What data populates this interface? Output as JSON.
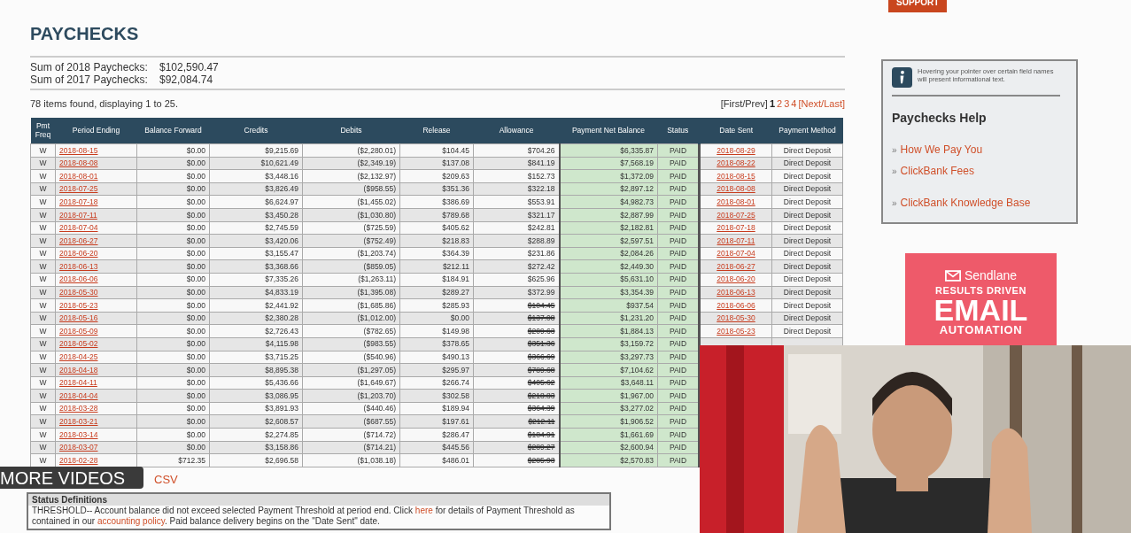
{
  "support_button": {
    "label": "SUPPORT"
  },
  "title": "PAYCHECKS",
  "sums": [
    {
      "label": "Sum of 2018 Paychecks:",
      "value": "$102,590.47"
    },
    {
      "label": "Sum of 2017 Paychecks:",
      "value": "$92,084.74"
    }
  ],
  "items_found": "78 items found, displaying 1 to 25.",
  "pager": {
    "first_prev": "[First/Prev]",
    "pages": [
      {
        "label": "1",
        "selected": true
      },
      {
        "label": "2",
        "selected": false
      },
      {
        "label": "3",
        "selected": false
      },
      {
        "label": "4",
        "selected": false
      }
    ],
    "next_last": "[Next/Last]"
  },
  "table": {
    "columns": [
      "Pmt Freq",
      "Period Ending",
      "Balance Forward",
      "Credits",
      "Debits",
      "Release",
      "Allowance",
      "Payment Net Balance",
      "Status",
      "Date Sent",
      "Payment Method"
    ],
    "rows": [
      {
        "freq": "W",
        "period_ending": "2018-08-15",
        "balance_forward": "$0.00",
        "credits": "$9,215.69",
        "debits": "($2,280.01)",
        "release": "$104.45",
        "allowance": "$704.26",
        "allowance_voided": false,
        "net_balance": "$6,335.87",
        "status": "PAID",
        "date_sent": "2018-08-29",
        "payment_method": "Direct Deposit"
      },
      {
        "freq": "W",
        "period_ending": "2018-08-08",
        "balance_forward": "$0.00",
        "credits": "$10,621.49",
        "debits": "($2,349.19)",
        "release": "$137.08",
        "allowance": "$841.19",
        "allowance_voided": false,
        "net_balance": "$7,568.19",
        "status": "PAID",
        "date_sent": "2018-08-22",
        "payment_method": "Direct Deposit"
      },
      {
        "freq": "W",
        "period_ending": "2018-08-01",
        "balance_forward": "$0.00",
        "credits": "$3,448.16",
        "debits": "($2,132.97)",
        "release": "$209.63",
        "allowance": "$152.73",
        "allowance_voided": false,
        "net_balance": "$1,372.09",
        "status": "PAID",
        "date_sent": "2018-08-15",
        "payment_method": "Direct Deposit"
      },
      {
        "freq": "W",
        "period_ending": "2018-07-25",
        "balance_forward": "$0.00",
        "credits": "$3,826.49",
        "debits": "($958.55)",
        "release": "$351.36",
        "allowance": "$322.18",
        "allowance_voided": false,
        "net_balance": "$2,897.12",
        "status": "PAID",
        "date_sent": "2018-08-08",
        "payment_method": "Direct Deposit"
      },
      {
        "freq": "W",
        "period_ending": "2018-07-18",
        "balance_forward": "$0.00",
        "credits": "$6,624.97",
        "debits": "($1,455.02)",
        "release": "$386.69",
        "allowance": "$553.91",
        "allowance_voided": false,
        "net_balance": "$4,982.73",
        "status": "PAID",
        "date_sent": "2018-08-01",
        "payment_method": "Direct Deposit"
      },
      {
        "freq": "W",
        "period_ending": "2018-07-11",
        "balance_forward": "$0.00",
        "credits": "$3,450.28",
        "debits": "($1,030.80)",
        "release": "$789.68",
        "allowance": "$321.17",
        "allowance_voided": false,
        "net_balance": "$2,887.99",
        "status": "PAID",
        "date_sent": "2018-07-25",
        "payment_method": "Direct Deposit"
      },
      {
        "freq": "W",
        "period_ending": "2018-07-04",
        "balance_forward": "$0.00",
        "credits": "$2,745.59",
        "debits": "($725.59)",
        "release": "$405.62",
        "allowance": "$242.81",
        "allowance_voided": false,
        "net_balance": "$2,182.81",
        "status": "PAID",
        "date_sent": "2018-07-18",
        "payment_method": "Direct Deposit"
      },
      {
        "freq": "W",
        "period_ending": "2018-06-27",
        "balance_forward": "$0.00",
        "credits": "$3,420.06",
        "debits": "($752.49)",
        "release": "$218.83",
        "allowance": "$288.89",
        "allowance_voided": false,
        "net_balance": "$2,597.51",
        "status": "PAID",
        "date_sent": "2018-07-11",
        "payment_method": "Direct Deposit"
      },
      {
        "freq": "W",
        "period_ending": "2018-06-20",
        "balance_forward": "$0.00",
        "credits": "$3,155.47",
        "debits": "($1,203.74)",
        "release": "$364.39",
        "allowance": "$231.86",
        "allowance_voided": false,
        "net_balance": "$2,084.26",
        "status": "PAID",
        "date_sent": "2018-07-04",
        "payment_method": "Direct Deposit"
      },
      {
        "freq": "W",
        "period_ending": "2018-06-13",
        "balance_forward": "$0.00",
        "credits": "$3,368.66",
        "debits": "($859.05)",
        "release": "$212.11",
        "allowance": "$272.42",
        "allowance_voided": false,
        "net_balance": "$2,449.30",
        "status": "PAID",
        "date_sent": "2018-06-27",
        "payment_method": "Direct Deposit"
      },
      {
        "freq": "W",
        "period_ending": "2018-06-06",
        "balance_forward": "$0.00",
        "credits": "$7,335.26",
        "debits": "($1,263.11)",
        "release": "$184.91",
        "allowance": "$625.96",
        "allowance_voided": false,
        "net_balance": "$5,631.10",
        "status": "PAID",
        "date_sent": "2018-06-20",
        "payment_method": "Direct Deposit"
      },
      {
        "freq": "W",
        "period_ending": "2018-05-30",
        "balance_forward": "$0.00",
        "credits": "$4,833.19",
        "debits": "($1,395.08)",
        "release": "$289.27",
        "allowance": "$372.99",
        "allowance_voided": false,
        "net_balance": "$3,354.39",
        "status": "PAID",
        "date_sent": "2018-06-13",
        "payment_method": "Direct Deposit"
      },
      {
        "freq": "W",
        "period_ending": "2018-05-23",
        "balance_forward": "$0.00",
        "credits": "$2,441.92",
        "debits": "($1,685.86)",
        "release": "$285.93",
        "allowance": "$104.45",
        "allowance_voided": true,
        "net_balance": "$937.54",
        "status": "PAID",
        "date_sent": "2018-06-06",
        "payment_method": "Direct Deposit"
      },
      {
        "freq": "W",
        "period_ending": "2018-05-16",
        "balance_forward": "$0.00",
        "credits": "$2,380.28",
        "debits": "($1,012.00)",
        "release": "$0.00",
        "allowance": "$137.08",
        "allowance_voided": true,
        "net_balance": "$1,231.20",
        "status": "PAID",
        "date_sent": "2018-05-30",
        "payment_method": "Direct Deposit"
      },
      {
        "freq": "W",
        "period_ending": "2018-05-09",
        "balance_forward": "$0.00",
        "credits": "$2,726.43",
        "debits": "($782.65)",
        "release": "$149.98",
        "allowance": "$209.63",
        "allowance_voided": true,
        "net_balance": "$1,884.13",
        "status": "PAID",
        "date_sent": "2018-05-23",
        "payment_method": "Direct Deposit"
      },
      {
        "freq": "W",
        "period_ending": "2018-05-02",
        "balance_forward": "$0.00",
        "credits": "$4,115.98",
        "debits": "($983.55)",
        "release": "$378.65",
        "allowance": "$351.36",
        "allowance_voided": true,
        "net_balance": "$3,159.72",
        "status": "PAID"
      },
      {
        "freq": "W",
        "period_ending": "2018-04-25",
        "balance_forward": "$0.00",
        "credits": "$3,715.25",
        "debits": "($540.96)",
        "release": "$490.13",
        "allowance": "$366.69",
        "allowance_voided": true,
        "net_balance": "$3,297.73",
        "status": "PAID"
      },
      {
        "freq": "W",
        "period_ending": "2018-04-18",
        "balance_forward": "$0.00",
        "credits": "$8,895.38",
        "debits": "($1,297.05)",
        "release": "$295.97",
        "allowance": "$789.68",
        "allowance_voided": true,
        "net_balance": "$7,104.62",
        "status": "PAID"
      },
      {
        "freq": "W",
        "period_ending": "2018-04-11",
        "balance_forward": "$0.00",
        "credits": "$5,436.66",
        "debits": "($1,649.67)",
        "release": "$266.74",
        "allowance": "$405.62",
        "allowance_voided": true,
        "net_balance": "$3,648.11",
        "status": "PAID"
      },
      {
        "freq": "W",
        "period_ending": "2018-04-04",
        "balance_forward": "$0.00",
        "credits": "$3,086.95",
        "debits": "($1,203.70)",
        "release": "$302.58",
        "allowance": "$218.83",
        "allowance_voided": true,
        "net_balance": "$1,967.00",
        "status": "PAID"
      },
      {
        "freq": "W",
        "period_ending": "2018-03-28",
        "balance_forward": "$0.00",
        "credits": "$3,891.93",
        "debits": "($440.46)",
        "release": "$189.94",
        "allowance": "$364.39",
        "allowance_voided": true,
        "net_balance": "$3,277.02",
        "status": "PAID"
      },
      {
        "freq": "W",
        "period_ending": "2018-03-21",
        "balance_forward": "$0.00",
        "credits": "$2,608.57",
        "debits": "($687.55)",
        "release": "$197.61",
        "allowance": "$212.11",
        "allowance_voided": true,
        "net_balance": "$1,906.52",
        "status": "PAID"
      },
      {
        "freq": "W",
        "period_ending": "2018-03-14",
        "balance_forward": "$0.00",
        "credits": "$2,274.85",
        "debits": "($714.72)",
        "release": "$286.47",
        "allowance": "$184.91",
        "allowance_voided": true,
        "net_balance": "$1,661.69",
        "status": "PAID"
      },
      {
        "freq": "W",
        "period_ending": "2018-03-07",
        "balance_forward": "$0.00",
        "credits": "$3,158.86",
        "debits": "($714.21)",
        "release": "$445.56",
        "allowance": "$289.27",
        "allowance_voided": true,
        "net_balance": "$2,600.94",
        "status": "PAID"
      },
      {
        "freq": "W",
        "period_ending": "2018-02-28",
        "balance_forward": "$712.35",
        "credits": "$2,696.58",
        "debits": "($1,038.18)",
        "release": "$486.01",
        "allowance": "$285.93",
        "allowance_voided": true,
        "net_balance": "$2,570.83",
        "status": "PAID"
      }
    ]
  },
  "csv_link": "CSV",
  "status_definitions": {
    "title": "Status Definitions",
    "text_before": "THRESHOLD-- Account balance did not exceed selected Payment Threshold at period end. Click",
    "link_here": "here",
    "text_middle": "for details of Payment Threshold as contained in our",
    "link_policy": "accounting policy",
    "text_after": ". Paid balance delivery begins on the \"Date Sent\" date."
  },
  "help_box": {
    "info_text": "Hovering your pointer over certain field names will present informational text.",
    "title": "Paychecks Help",
    "links": [
      {
        "marker": "»",
        "label": "How We Pay You"
      },
      {
        "marker": "»",
        "label": "ClickBank Fees"
      },
      {
        "marker": "»",
        "label": "ClickBank Knowledge Base"
      }
    ]
  },
  "ad": {
    "brand": "Sendlane",
    "tagline": "RESULTS DRIVEN",
    "headline": "EMAIL",
    "subhead": "AUTOMATION"
  },
  "video_overlay": {
    "more_videos": "MORE VIDEOS"
  }
}
